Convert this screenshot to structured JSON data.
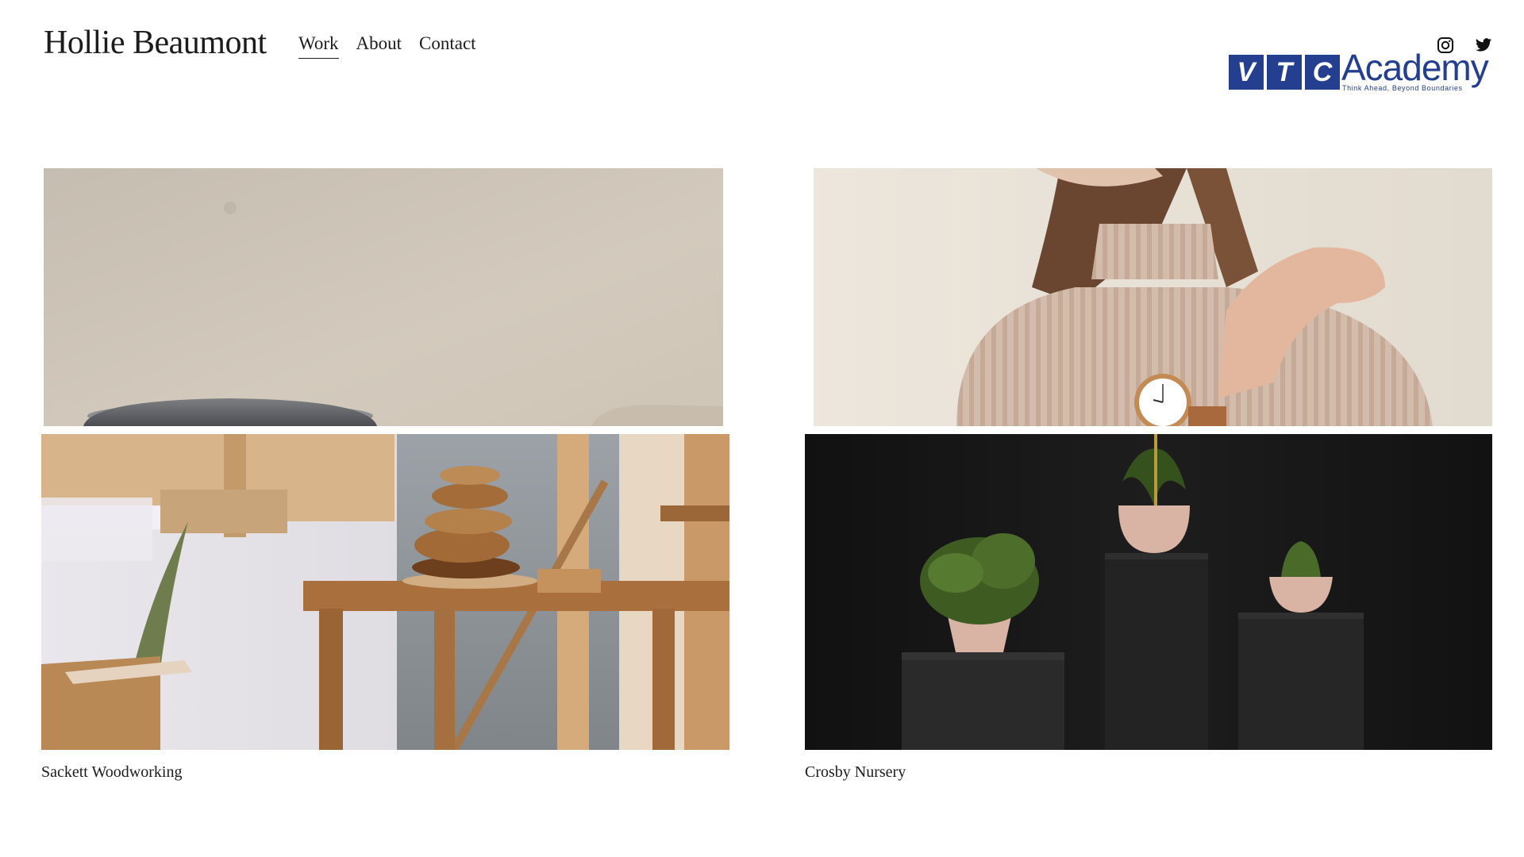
{
  "site": {
    "title": "Hollie Beaumont"
  },
  "nav": [
    {
      "label": "Work",
      "active": true
    },
    {
      "label": "About",
      "active": false
    },
    {
      "label": "Contact",
      "active": false
    }
  ],
  "social": [
    {
      "icon": "instagram-icon"
    },
    {
      "icon": "twitter-icon"
    }
  ],
  "watermark": {
    "letters": [
      "V",
      "T",
      "C"
    ],
    "word": "Academy",
    "tagline": "Think Ahead, Beyond Boundaries",
    "color": "#243f8f"
  },
  "gallery": {
    "top_row": [
      {
        "alt": "Bowl against beige wall"
      },
      {
        "alt": "Woman in turtleneck with watch"
      }
    ],
    "projects": [
      {
        "caption": "Sackett Woodworking"
      },
      {
        "caption": "Crosby Nursery"
      }
    ]
  },
  "colors": {
    "text": "#1c1c1c",
    "beige_wall": "#cbc2b4",
    "dark_backdrop": "#141414",
    "wood": "#b07a45",
    "pot_pink": "#d9b3a3"
  }
}
